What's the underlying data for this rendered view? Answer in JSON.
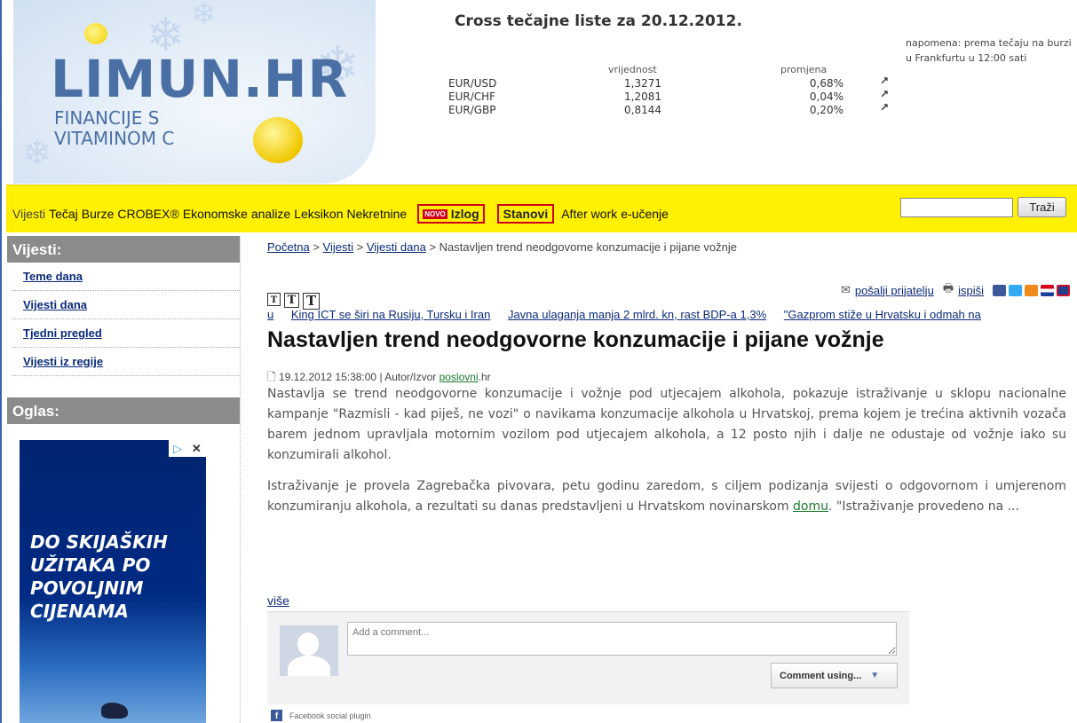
{
  "brand": {
    "logo_text": "LIMUN.HR",
    "tagline_line1": "FINANCIJE S",
    "tagline_line2": "VITAMINOM C",
    "colors": {
      "logo": "#4a6fa5",
      "nav_bg": "#fff101",
      "badge_red": "#d3001c",
      "link": "#0a2a7a"
    }
  },
  "exchange": {
    "title": "Cross tečajne liste za 20.12.2012.",
    "note": "napomena: prema tečaju na burzi u Frankfurtu u 12:00 sati",
    "col_value": "vrijednost",
    "col_change": "promjena",
    "rows": [
      {
        "pair": "EUR/USD",
        "value": "1,3271",
        "change": "0,68%",
        "arrow": "↗"
      },
      {
        "pair": "EUR/CHF",
        "value": "1,2081",
        "change": "0,04%",
        "arrow": "↗"
      },
      {
        "pair": "EUR/GBP",
        "value": "0,8144",
        "change": "0,20%",
        "arrow": "↗"
      }
    ]
  },
  "nav": {
    "items": [
      "Vijesti",
      "Tečaj",
      "Burze",
      "CROBEX®",
      "Ekonomske analize",
      "Leksikon",
      "Nekretnine"
    ],
    "novo_label": "NOVO",
    "izlog_label": "Izlog",
    "stanovi_label": "Stanovi",
    "after_items": [
      "After work",
      "e-učenje"
    ],
    "search_button": "Traži",
    "search_value": ""
  },
  "sidebar": {
    "news_header": "Vijesti:",
    "items": [
      "Teme dana",
      "Vijesti dana",
      "Tjedni pregled",
      "Vijesti iz regije"
    ],
    "ads_header": "Oglas:",
    "ad_text": [
      "DO SKIJAŠKIH",
      "UŽITAKA PO",
      "POVOLJNIM",
      "CIJENAMA"
    ]
  },
  "article": {
    "breadcrumb": [
      "Početna",
      "Vijesti",
      "Vijesti dana"
    ],
    "breadcrumb_current": "Nastavljen trend neodgovorne konzumacije i pijane vožnje",
    "breadcrumb_sep": ">",
    "send_to_friend": "pošalji prijatelju",
    "print": "ispiši",
    "font_size_labels": [
      "T",
      "T",
      "T"
    ],
    "ticker": [
      "u",
      "King ICT se širi na Rusiju, Tursku i Iran",
      "Javna ulaganja manja 2 mlrd. kn, rast BDP-a 1,3%",
      "\"Gazprom stiže u Hrvatsku i odmah na"
    ],
    "headline": "Nastavljen trend neodgovorne konzumacije i pijane vožnje",
    "meta_date": "19.12.2012 15:38:00 | Autor/Izvor",
    "meta_source_link": "poslovni",
    "meta_source_suffix": ".hr",
    "paragraph1": "Nastavlja se trend neodgovorne konzumacije i vožnje pod utjecajem alkohola, pokazuje istraživanje u sklopu nacionalne kampanje \"Razmisli - kad piješ, ne vozi\" o navikama konzumacije alkohola u Hrvatskoj, prema kojem je trećina aktivnih vozača barem jednom upravljala motornim vozilom pod utjecajem alkohola, a 12 posto njih i dalje ne odustaje od vožnje iako su konzumirali alkohol.",
    "paragraph2_a": "Istraživanje je provela Zagrebačka pivovara, petu godinu zaredom, s ciljem podizanja svijesti o odgovornom i umjerenom konzumiranju alkohola, a rezultati su danas predstavljeni u Hrvatskom novinarskom",
    "paragraph2_link": "domu",
    "paragraph2_b": ". \"Istraživanje provedeno na ...",
    "more_link": "više"
  },
  "comments": {
    "placeholder": "Add a comment...",
    "comment_using": "Comment using...",
    "plugin_label": "Facebook social plugin"
  }
}
